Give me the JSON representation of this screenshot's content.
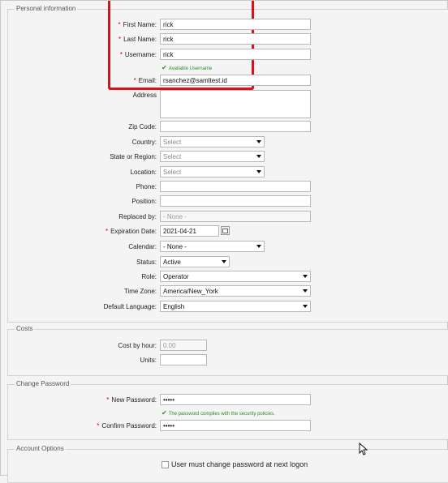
{
  "sections": {
    "personal": "Personal information",
    "costs": "Costs",
    "change_password": "Change Password",
    "account_options": "Account Options"
  },
  "form": {
    "first_name": {
      "label": "First Name:",
      "value": "rick"
    },
    "last_name": {
      "label": "Last Name:",
      "value": "rick"
    },
    "username": {
      "label": "Username:",
      "value": "rick",
      "hint": "Available Username"
    },
    "email": {
      "label": "Email:",
      "value": "rsanchez@samltest.id"
    },
    "address": {
      "label": "Address",
      "value": ""
    },
    "zip_code": {
      "label": "Zip Code:",
      "value": ""
    },
    "country": {
      "label": "Country:",
      "value": "Select"
    },
    "state": {
      "label": "State or Region:",
      "value": "Select"
    },
    "location": {
      "label": "Location:",
      "value": "Select"
    },
    "phone": {
      "label": "Phone:",
      "value": ""
    },
    "position": {
      "label": "Position:",
      "value": ""
    },
    "replaced_by": {
      "label": "Replaced by:",
      "value": "- None -"
    },
    "expiration_date": {
      "label": "Expiration Date:",
      "value": "2021-04-21"
    },
    "calendar": {
      "label": "Calendar:",
      "value": "- None -"
    },
    "status": {
      "label": "Status:",
      "value": "Active"
    },
    "role": {
      "label": "Role:",
      "value": "Operator"
    },
    "time_zone": {
      "label": "Time Zone:",
      "value": "America/New_York"
    },
    "default_language": {
      "label": "Default Language:",
      "value": "English"
    }
  },
  "costs": {
    "cost_by_hour": {
      "label": "Cost by hour:",
      "value": "0.00"
    },
    "units": {
      "label": "Units:",
      "value": ""
    }
  },
  "password": {
    "new": {
      "label": "New Password:",
      "value": "•••••",
      "hint": "The password complies with the security policies."
    },
    "confirm": {
      "label": "Confirm Password:",
      "value": "•••••"
    }
  },
  "account_options": {
    "must_change_label": "User must change password at next logon"
  },
  "required_mark": "*",
  "colors": {
    "highlight": "#d4141d",
    "hint": "#2e8b2e",
    "required": "#d00000"
  }
}
